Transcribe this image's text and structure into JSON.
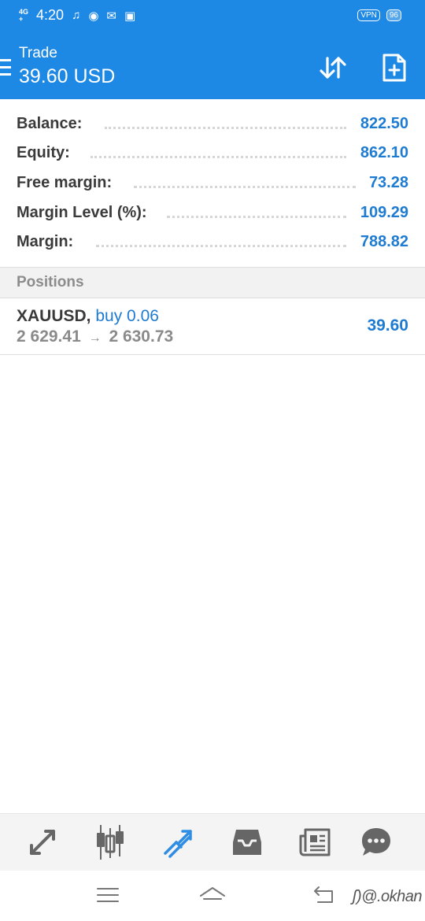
{
  "status_bar": {
    "network_top": "4G",
    "network_bottom": "+",
    "time": "4:20",
    "icons": [
      "music-note-icon",
      "messenger-icon",
      "gmail-icon",
      "photo-icon"
    ],
    "vpn": "VPN",
    "battery": "96"
  },
  "header": {
    "title": "Trade",
    "amount": "39.60 USD"
  },
  "account": {
    "rows": [
      {
        "label": "Balance:",
        "value": "822.50"
      },
      {
        "label": "Equity:",
        "value": "862.10"
      },
      {
        "label": "Free margin:",
        "value": "73.28"
      },
      {
        "label": "Margin Level (%):",
        "value": "109.29"
      },
      {
        "label": "Margin:",
        "value": "788.82"
      }
    ]
  },
  "positions": {
    "header": "Positions",
    "items": [
      {
        "symbol": "XAUUSD,",
        "side": "buy 0.06",
        "open_price": "2 629.41",
        "arrow": "→",
        "current_price": "2 630.73",
        "profit": "39.60"
      }
    ]
  },
  "bottom_nav": {
    "items": [
      "quotes-icon",
      "chart-icon",
      "trade-icon",
      "history-icon",
      "news-icon",
      "messages-icon"
    ],
    "active": "trade-icon"
  },
  "watermark": "ʃ)@.okhan",
  "colors": {
    "brand_blue": "#1e88e5",
    "value_blue": "#1e7bd2",
    "label_dark": "#3a3a3a",
    "muted_gray": "#8a8a8a"
  }
}
